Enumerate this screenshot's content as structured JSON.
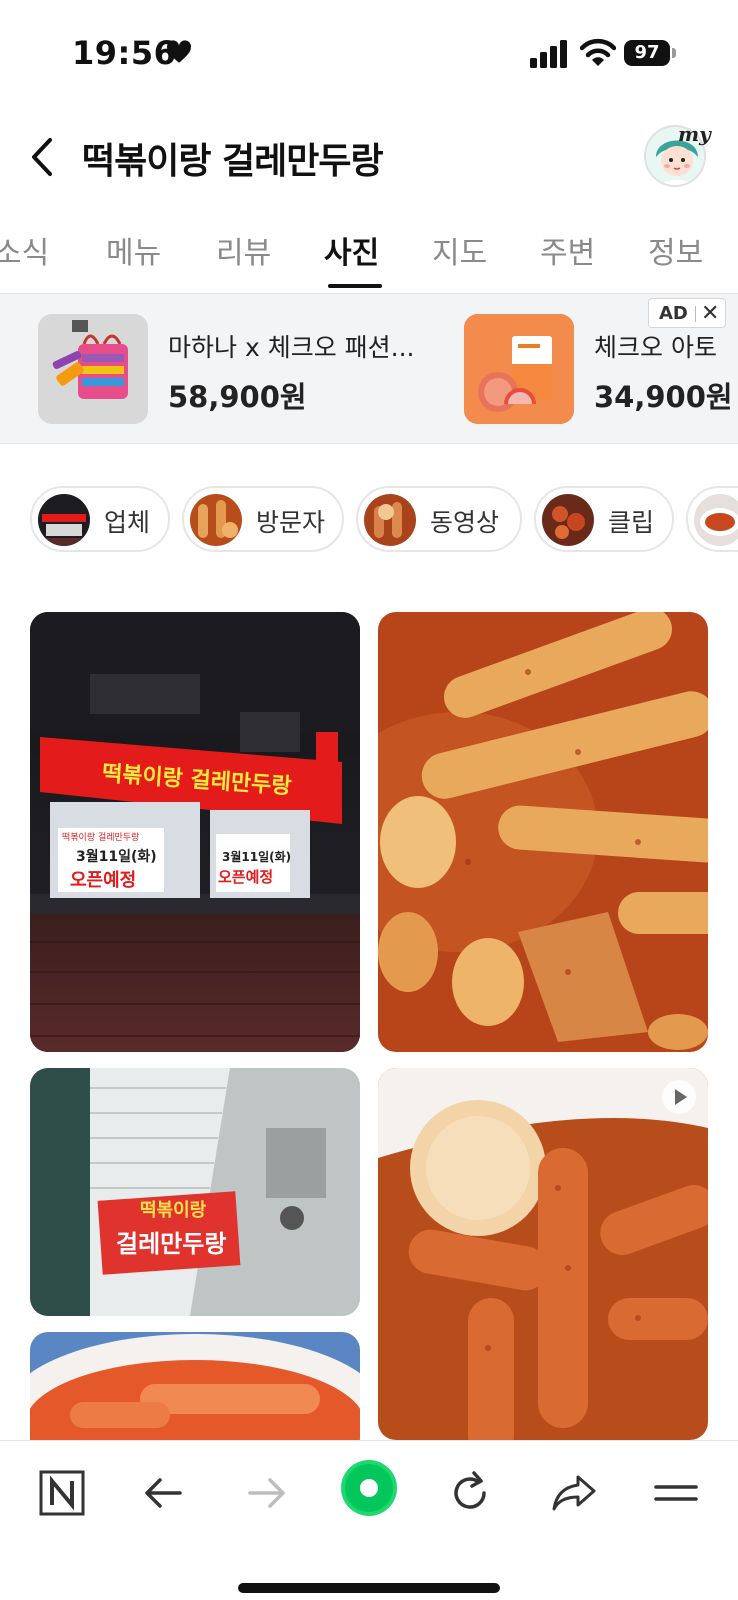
{
  "status": {
    "time": "19:56",
    "battery": "97"
  },
  "header": {
    "title": "떡볶이랑 걸레만두랑",
    "my_label": "my"
  },
  "tabs": [
    {
      "label": "소식"
    },
    {
      "label": "메뉴"
    },
    {
      "label": "리뷰"
    },
    {
      "label": "사진",
      "active": true
    },
    {
      "label": "지도"
    },
    {
      "label": "주변"
    },
    {
      "label": "정보"
    }
  ],
  "ad": {
    "badge": "AD",
    "close": "✕",
    "items": [
      {
        "name": "마하나 x 체크오 패션...",
        "price": "58,900원"
      },
      {
        "name": "체크오 아토",
        "price": "34,900원"
      }
    ]
  },
  "chips": [
    {
      "label": "업체"
    },
    {
      "label": "방문자"
    },
    {
      "label": "동영상"
    },
    {
      "label": "클립"
    },
    {
      "label": ""
    }
  ],
  "photos": {
    "storefront_sign_main": "떡볶이랑 걸레만두랑",
    "storefront_side_sign": "걸레만두랑",
    "poster_date": "3월11일(화)",
    "poster_open": "오픈예정",
    "poster_head": "떡볶이랑 걸레만두랑",
    "hanging_sign_line1": "떡볶이랑",
    "hanging_sign_line2": "걸레만두랑"
  },
  "colors": {
    "accent_green": "#03c75a",
    "sign_red": "#e31b1b",
    "sauce": "#c0461a"
  },
  "icons": {
    "home": "naver-n-icon",
    "back": "arrow-left-icon",
    "forward": "arrow-right-icon",
    "center": "green-circle-icon",
    "refresh": "refresh-icon",
    "share": "share-icon",
    "menu": "hamburger-icon"
  }
}
